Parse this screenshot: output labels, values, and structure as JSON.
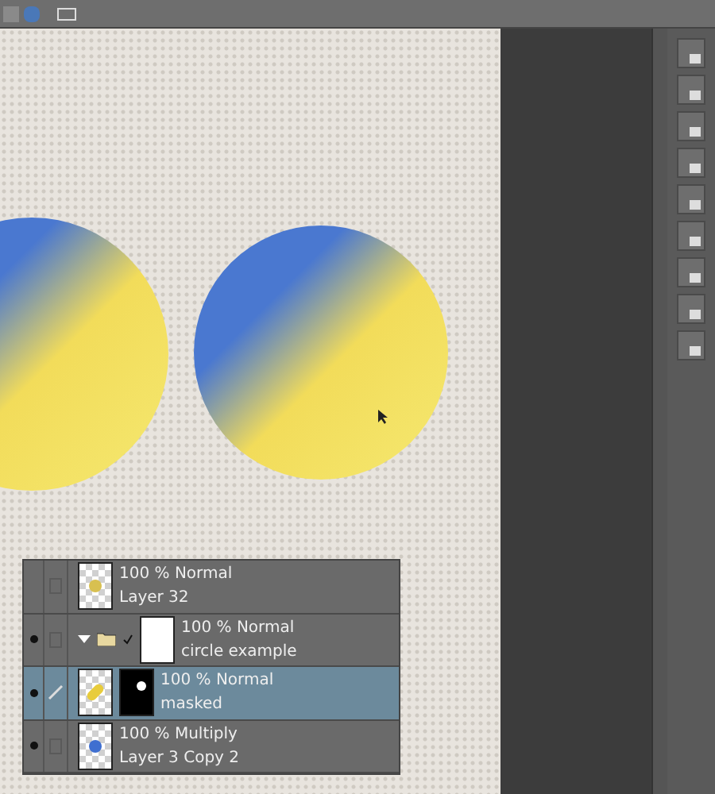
{
  "layers": [
    {
      "kind": "layer",
      "opacity_blend": "100 % Normal",
      "name": "Layer 32",
      "visible": false,
      "selected": false,
      "color": "#d8c050"
    },
    {
      "kind": "folder",
      "opacity_blend": "100 % Normal",
      "name": "circle example",
      "visible": true,
      "selected": false,
      "expanded": true
    },
    {
      "kind": "masked",
      "opacity_blend": "100 % Normal",
      "name": "masked",
      "visible": true,
      "selected": true,
      "color": "#e8cc3c"
    },
    {
      "kind": "layer",
      "opacity_blend": "100 % Multiply",
      "name": "Layer 3 Copy 2",
      "visible": true,
      "selected": false,
      "color": "#3f6fd0"
    }
  ]
}
